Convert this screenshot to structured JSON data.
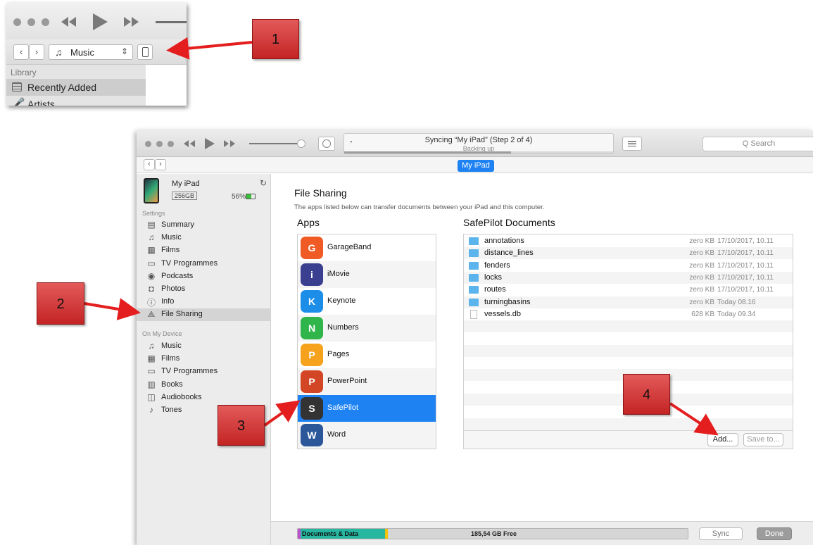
{
  "inset": {
    "source_label": "Music",
    "library_label": "Library",
    "library_item": "Recently Added",
    "partial_item": "Artists"
  },
  "toolbar": {
    "sync_title": "Syncing “My iPad” (Step 2 of 4)",
    "sync_subtitle": "Backing up",
    "search_placeholder": "Q Search",
    "sync_progress": 0.62
  },
  "device_tab": "My iPad",
  "device": {
    "name": "My iPad",
    "capacity": "256GB",
    "battery": "56%"
  },
  "sidebar": {
    "settings_header": "Settings",
    "settings": [
      {
        "label": "Summary",
        "icon": "summary-icon"
      },
      {
        "label": "Music",
        "icon": "music-note-icon"
      },
      {
        "label": "Films",
        "icon": "film-icon"
      },
      {
        "label": "TV Programmes",
        "icon": "tv-icon"
      },
      {
        "label": "Podcasts",
        "icon": "podcast-icon"
      },
      {
        "label": "Photos",
        "icon": "camera-icon"
      },
      {
        "label": "Info",
        "icon": "info-icon"
      },
      {
        "label": "File Sharing",
        "icon": "file-sharing-icon"
      }
    ],
    "device_header": "On My Device",
    "on_device": [
      {
        "label": "Music",
        "icon": "music-note-icon"
      },
      {
        "label": "Films",
        "icon": "film-icon"
      },
      {
        "label": "TV Programmes",
        "icon": "tv-icon"
      },
      {
        "label": "Books",
        "icon": "book-icon"
      },
      {
        "label": "Audiobooks",
        "icon": "audiobook-icon"
      },
      {
        "label": "Tones",
        "icon": "bell-icon"
      }
    ]
  },
  "file_sharing": {
    "title": "File Sharing",
    "description": "The apps listed below can transfer documents between your iPad and this computer.",
    "apps_header": "Apps",
    "docs_header": "SafePilot Documents",
    "apps": [
      {
        "name": "GarageBand",
        "color": "#f05a24"
      },
      {
        "name": "iMovie",
        "color": "#3a3f8f"
      },
      {
        "name": "Keynote",
        "color": "#1d8ee8"
      },
      {
        "name": "Numbers",
        "color": "#2fb54a"
      },
      {
        "name": "Pages",
        "color": "#f6a21c"
      },
      {
        "name": "PowerPoint",
        "color": "#d24625"
      },
      {
        "name": "SafePilot",
        "color": "#333333"
      },
      {
        "name": "Word",
        "color": "#2b579a"
      }
    ],
    "selected_app": "SafePilot",
    "documents": [
      {
        "name": "annotations",
        "size": "zero KB",
        "date": "17/10/2017, 10.11",
        "type": "folder"
      },
      {
        "name": "distance_lines",
        "size": "zero KB",
        "date": "17/10/2017, 10.11",
        "type": "folder"
      },
      {
        "name": "fenders",
        "size": "zero KB",
        "date": "17/10/2017, 10.11",
        "type": "folder"
      },
      {
        "name": "locks",
        "size": "zero KB",
        "date": "17/10/2017, 10.11",
        "type": "folder"
      },
      {
        "name": "routes",
        "size": "zero KB",
        "date": "17/10/2017, 10.11",
        "type": "folder"
      },
      {
        "name": "turningbasins",
        "size": "zero KB",
        "date": "Today 08.16",
        "type": "folder"
      },
      {
        "name": "vessels.db",
        "size": "628 KB",
        "date": "Today 09.34",
        "type": "file"
      }
    ],
    "add_button": "Add...",
    "save_button": "Save to..."
  },
  "storage": {
    "docs_label": "Documents & Data",
    "free_label": "185,54 GB Free",
    "sync_button": "Sync",
    "done_button": "Done"
  },
  "callouts": [
    "1",
    "2",
    "3",
    "4"
  ],
  "colors": {
    "accent": "#1e82f2",
    "selection": "#1e82f2",
    "folder": "#5bb4ec",
    "callout": "#d23a3a",
    "arrow": "#e41e1e"
  }
}
